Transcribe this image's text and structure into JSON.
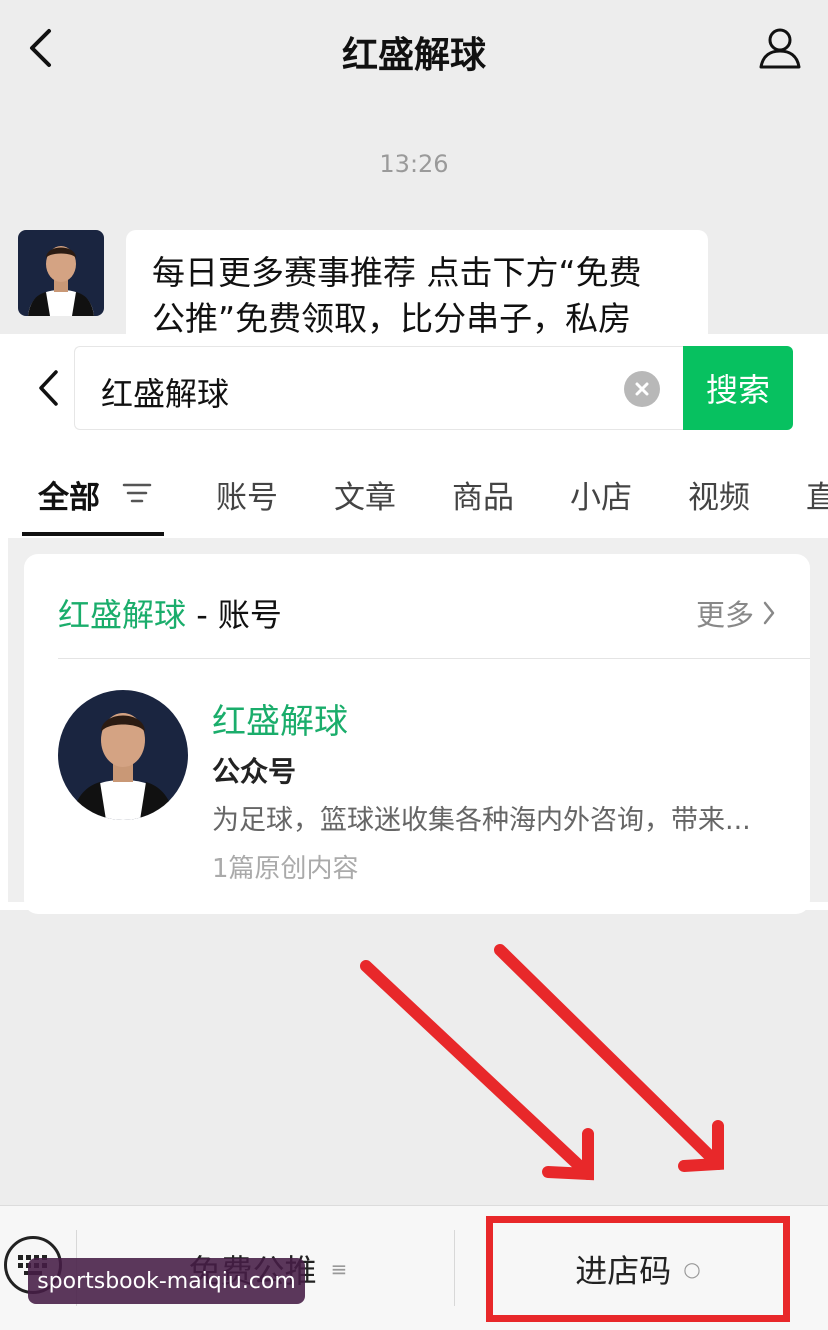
{
  "chat": {
    "title": "红盛解球",
    "timestamp": "13:26",
    "message_line1": "每日更多赛事推荐 点击下方“免费",
    "message_line2": "公推”免费领取，比分串子，私房"
  },
  "search": {
    "query": "红盛解球",
    "button_label": "搜索",
    "tabs": [
      "全部",
      "账号",
      "文章",
      "商品",
      "小店",
      "视频",
      "直"
    ]
  },
  "result": {
    "header_keyword": "红盛解球",
    "header_suffix": " - 账号",
    "more_label": "更多",
    "account_name": "红盛解球",
    "account_type": "公众号",
    "account_desc": "为足球，篮球迷收集各种海内外咨询，带来...",
    "account_meta": "1篇原创内容"
  },
  "menu": {
    "item1_label": "免费公推",
    "item2_label": "进店码"
  },
  "watermark": "sportsbook-maiqiu.com",
  "colors": {
    "accent_green": "#07c160",
    "highlight_red": "#e8282a",
    "background": "#ededed"
  },
  "icons": {
    "back": "chevron-left-icon",
    "profile": "person-icon",
    "clear": "clear-icon",
    "filter": "filter-icon",
    "more": "chevron-right-icon",
    "keyboard": "keyboard-icon"
  }
}
